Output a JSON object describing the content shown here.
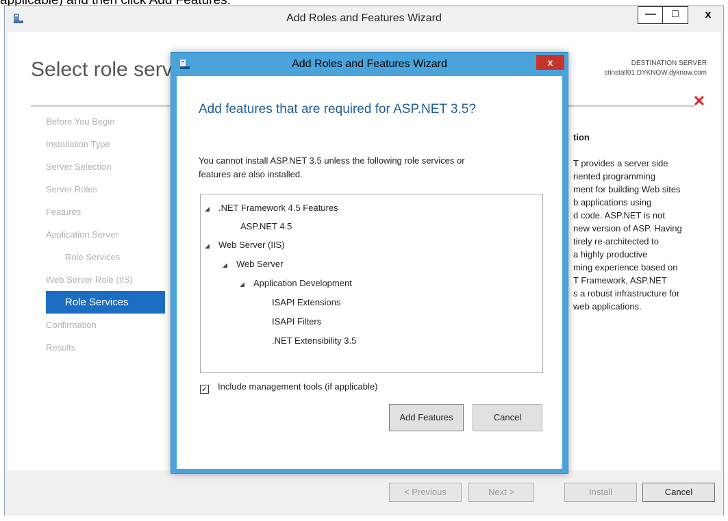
{
  "caption": "applicable) and then click Add Features.",
  "outer": {
    "title": "Add Roles and Features Wizard",
    "min_symbol": "—",
    "max_symbol": "□",
    "close_symbol": "x",
    "heading": "Select role services",
    "destination_label": "DESTINATION SERVER",
    "destination_server": "stinstall01.DYKNOW.dyknow.com",
    "red_x": "✕",
    "nav": [
      "Before You Begin",
      "Installation Type",
      "Server Selection",
      "Server Roles",
      "Features",
      "Application Server",
      "Role Services",
      "Web Server Role (IIS)",
      "Role Services",
      "Confirmation",
      "Results"
    ],
    "description_title": "tion",
    "description_text": "T provides a server side\nriented programming\nment for building Web sites\nb applications using\nd code. ASP.NET is not\nnew version of ASP. Having\ntirely re-architected to\na highly productive\nming experience based on\nT Framework, ASP.NET\ns a robust infrastructure for\nweb applications.",
    "buttons": {
      "previous": "< Previous",
      "next": "Next >",
      "install": "Install",
      "cancel": "Cancel"
    }
  },
  "dialog": {
    "title": "Add Roles and Features Wizard",
    "close_symbol": "x",
    "heading": "Add features that are required for ASP.NET 3.5?",
    "message": "You cannot install ASP.NET 3.5 unless the following role services or\nfeatures are also installed.",
    "tree": [
      {
        "label": ".NET Framework 4.5 Features",
        "expander": "◢"
      },
      {
        "label": "ASP.NET 4.5",
        "expander": ""
      },
      {
        "label": "Web Server (IIS)",
        "expander": "◢"
      },
      {
        "label": "Web Server",
        "expander": "◢"
      },
      {
        "label": "Application Development",
        "expander": "◢"
      },
      {
        "label": "ISAPI Extensions",
        "expander": ""
      },
      {
        "label": "ISAPI Filters",
        "expander": ""
      },
      {
        "label": ".NET Extensibility 3.5",
        "expander": ""
      }
    ],
    "checkbox_mark": "✓",
    "checkbox_label": "Include management tools (if applicable)",
    "add_button": "Add Features",
    "cancel_button": "Cancel"
  }
}
